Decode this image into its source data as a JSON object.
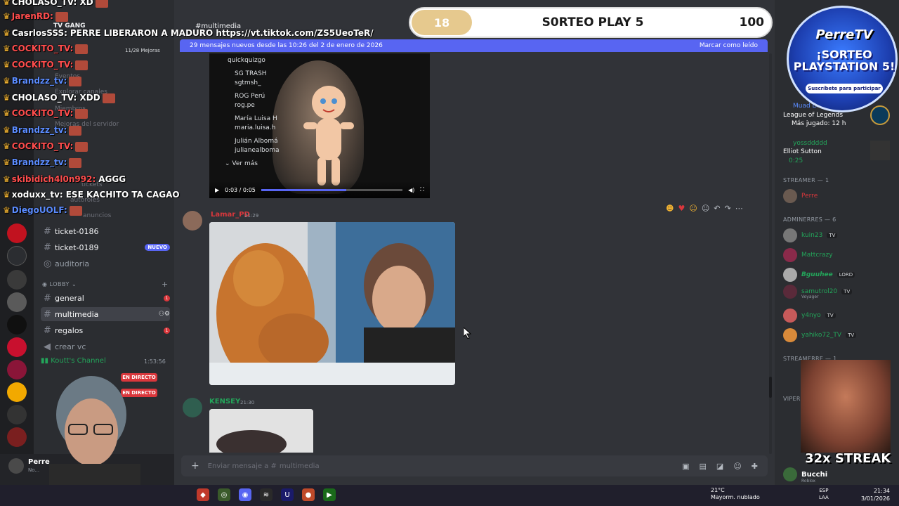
{
  "overlay_chat": [
    {
      "user": "CHOLASO_TV: XD",
      "text": ""
    },
    {
      "user": "JarenRD:",
      "text": ""
    },
    {
      "user": "CasrlosSSS:",
      "text": "PERRE LIBERARON A MADURO https://vt.tiktok.com/ZS5UeoTeR/"
    },
    {
      "user": "COCKITO_TV:",
      "text": ""
    },
    {
      "user": "COCKITO_TV:",
      "text": ""
    },
    {
      "user": "Brandzz_tv:",
      "text": ""
    },
    {
      "user": "CHOLASO_TV: XDD",
      "text": ""
    },
    {
      "user": "COCKITO_TV:",
      "text": ""
    },
    {
      "user": "Brandzz_tv:",
      "text": ""
    },
    {
      "user": "COCKITO_TV:",
      "text": ""
    },
    {
      "user": "Brandzz_tv:",
      "text": ""
    },
    {
      "user": "skibidich4l0n992:",
      "text": "AGGG"
    },
    {
      "user": "xoduxx_tv:",
      "text": "ESE KACHITO TA CAGAO"
    },
    {
      "user": "DiegoUOLF:",
      "text": ""
    }
  ],
  "channels": {
    "server_name": "TV GANG",
    "items": [
      {
        "name": "ticket-0186"
      },
      {
        "name": "ticket-0189",
        "badge": "NUEVO"
      },
      {
        "name": "auditoria"
      }
    ],
    "category_lobby": "LOBBY",
    "lobby": [
      {
        "name": "general",
        "unread": "1"
      },
      {
        "name": "multimedia",
        "active": true
      },
      {
        "name": "regalos",
        "unread": "1"
      },
      {
        "name": "crear vc"
      }
    ],
    "voice_channel": "Koutt's Channel",
    "voice_time": "1:53:56",
    "live_label": "EN DIRECTO",
    "boost_label": "11/28 Mejoras",
    "faded": [
      "Eventos",
      "Explorar canales",
      "Miembros",
      "Mejoras del servidor",
      "tickets",
      "autoroles",
      "anuncios"
    ]
  },
  "user_panel": {
    "name": "Perre",
    "status": "No..."
  },
  "main": {
    "channel_title": "multimedia",
    "banner_text": "29 mensajes nuevos desde las 10:26 del 2 de enero de 2026",
    "banner_action": "Marcar como leído",
    "media1_list": [
      "quickquizgo",
      "SG TRASH",
      "sgtmsh_",
      "ROG Perú",
      "rog.pe",
      "María Luisa H",
      "maria.luisa.h",
      "Julián Albomá",
      "julianealboma"
    ],
    "media1_more": "Ver más",
    "media1_time": "0:03 / 0:05",
    "media1_progress": 0.6,
    "msg2_author": "Lamar_PD",
    "msg2_time": "21:29",
    "msg3_author": "KENSEY",
    "msg3_time": "21:30",
    "composer_placeholder": "Enviar mensaje a #",
    "composer_channel": "multimedia"
  },
  "raffle": {
    "number": "18",
    "title": "S0RTEO PLAY 5",
    "total": "100"
  },
  "promo": {
    "brand": "PerreTV",
    "title_line1": "¡SORTEO",
    "title_line2": "PLAYSTATION 5!",
    "subtitle": "Suscríbete para participar"
  },
  "members": {
    "activity1_user": "Muad Dib",
    "activity1_game": "League of Legends",
    "activity1_time": "Más jugado: 12 h",
    "activity2_user": "yossddddd",
    "activity2_name": "Elliot Sutton",
    "activity2_time": "0:25",
    "group_streamer": "STREAMER — 1",
    "streamer_name": "Perre",
    "group_admins": "ADMINERRES — 6",
    "admins": [
      {
        "name": "kuin23",
        "tag": "TV"
      },
      {
        "name": "Mattcrazy",
        "tag": ""
      },
      {
        "name": "Bguuhee",
        "tag": "LORD"
      },
      {
        "name": "samutrol20",
        "tag": "TV",
        "sub": "Voyager"
      },
      {
        "name": "y4nyo",
        "tag": "TV"
      },
      {
        "name": "yahiko72_TV",
        "tag": "TV"
      }
    ],
    "group_streamerre": "STREAMERRE — 1",
    "group_vip": "VIPER",
    "last_member": "Bucchi",
    "last_sub": "Roblox"
  },
  "streak": "32x STREAK",
  "taskbar": {
    "weather_temp": "21°C",
    "weather_desc": "Mayorm. nublado",
    "lang1": "ESP",
    "lang2": "LAA",
    "time": "21:34",
    "date": "3/01/2026"
  },
  "colors": {
    "accent": "#5865f2",
    "live": "#da373c",
    "online": "#23a55a",
    "raffle_num": "#e6c98e"
  }
}
